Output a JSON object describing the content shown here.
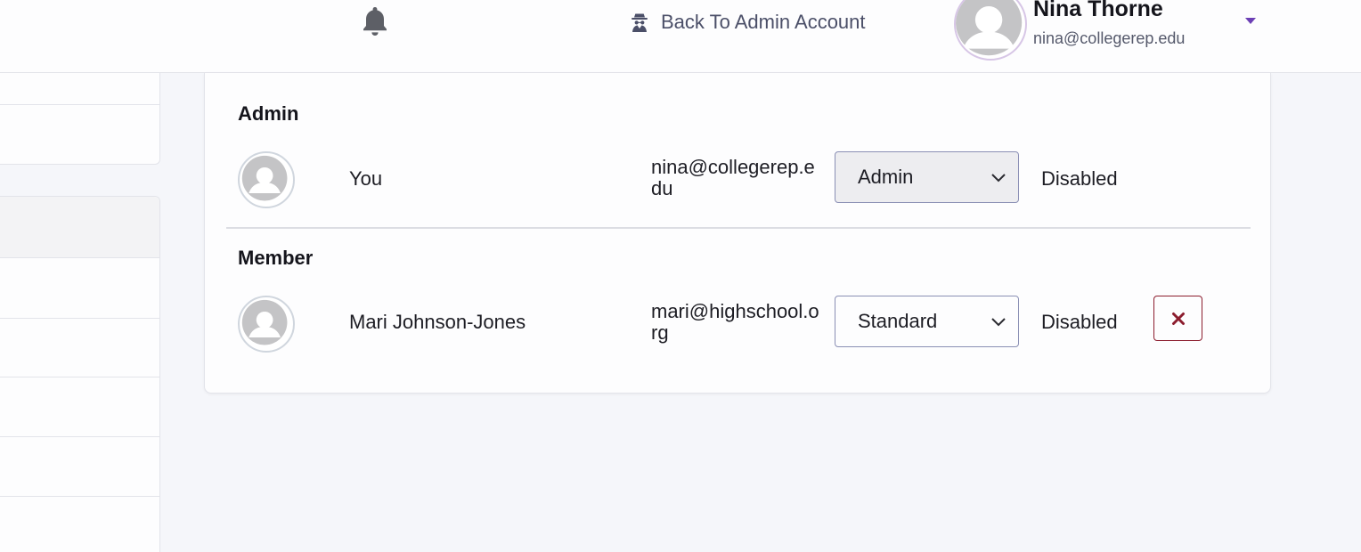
{
  "header": {
    "back_label": "Back To Admin Account",
    "user_name": "Nina Thorne",
    "user_email": "nina@collegerep.edu"
  },
  "sections": [
    {
      "title": "Admin",
      "rows": [
        {
          "name": "You",
          "email": "nina@collegerep.edu",
          "role": "Admin",
          "status": "Disabled",
          "removable": false
        }
      ]
    },
    {
      "title": "Member",
      "rows": [
        {
          "name": "Mari Johnson-Jones",
          "email": "mari@highschool.org",
          "role": "Standard",
          "status": "Disabled",
          "removable": true
        }
      ]
    }
  ],
  "icons": {
    "bell": "bell-icon",
    "back": "user-secret-icon",
    "dropdown": "caret-down-icon",
    "select": "chevron-down-icon",
    "remove": "close-icon"
  },
  "colors": {
    "accent": "#6c3fb5",
    "danger": "#8c1d2e",
    "link": "#4b4f68"
  }
}
